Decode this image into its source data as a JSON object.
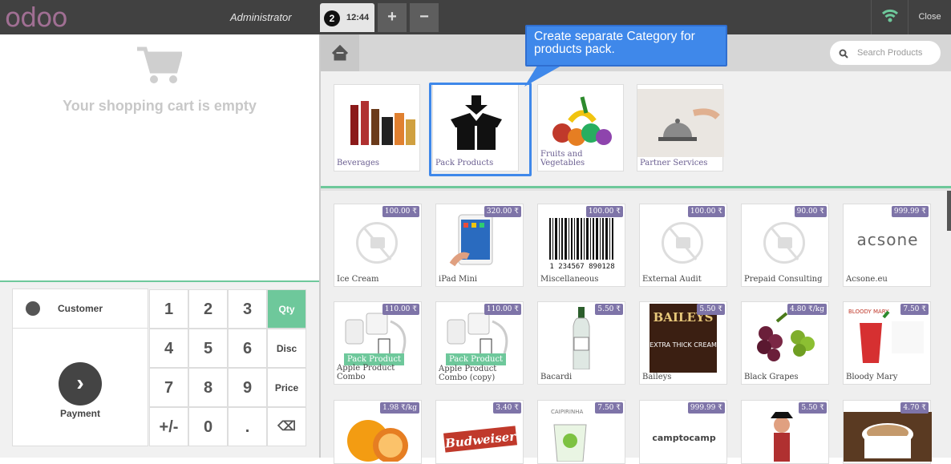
{
  "topbar": {
    "logo": "odoo",
    "user": "Administrator",
    "order_number": "2",
    "order_time": "12:44",
    "add_label": "+",
    "remove_label": "−",
    "close_label": "Close"
  },
  "cart": {
    "empty_text": "Your shopping cart is empty"
  },
  "actionpad": {
    "customer_label": "Customer",
    "payment_label": "Payment"
  },
  "numpad": {
    "keys": [
      "1",
      "2",
      "3",
      "4",
      "5",
      "6",
      "7",
      "8",
      "9",
      "+/-",
      "0",
      "."
    ],
    "modes": [
      "Qty",
      "Disc",
      "Price"
    ],
    "backspace": "⌫"
  },
  "search": {
    "placeholder": "Search Products"
  },
  "callout": {
    "text": "Create separate  Category for products pack."
  },
  "categories": [
    {
      "name": "Beverages"
    },
    {
      "name": "Pack Products"
    },
    {
      "name": "Fruits and Vegetables"
    },
    {
      "name": "Partner Services"
    }
  ],
  "products": {
    "row1": [
      {
        "name": "Ice Cream",
        "price": "100.00 ₹"
      },
      {
        "name": "iPad Mini",
        "price": "320.00 ₹"
      },
      {
        "name": "Miscellaneous",
        "price": "100.00 ₹"
      },
      {
        "name": "External Audit",
        "price": "100.00 ₹"
      },
      {
        "name": "Prepaid Consulting",
        "price": "90.00 ₹"
      },
      {
        "name": "Acsone.eu",
        "price": "999.99 ₹"
      }
    ],
    "row2": [
      {
        "name": "Apple Product Combo",
        "price": "110.00 ₹",
        "badge": "Pack Product"
      },
      {
        "name": "Apple Product Combo (copy)",
        "price": "110.00 ₹",
        "badge": "Pack Product"
      },
      {
        "name": "Bacardi",
        "price": "5.50 ₹"
      },
      {
        "name": "Baileys",
        "price": "5.50 ₹"
      },
      {
        "name": "Black Grapes",
        "price": "4.80 ₹/kg"
      },
      {
        "name": "Bloody Mary",
        "price": "7.50 ₹"
      }
    ],
    "row3": [
      {
        "price": "1.98 ₹/kg"
      },
      {
        "price": "3.40 ₹"
      },
      {
        "price": "7.50 ₹"
      },
      {
        "price": "999.99 ₹"
      },
      {
        "price": "5.50 ₹"
      },
      {
        "price": "4.70 ₹"
      }
    ]
  },
  "logos": {
    "acsone": "acsone",
    "camptocamp": "camptocamp",
    "budweiser": "Budweiser",
    "baileys": "BAILEYS",
    "baileys_sub": "EXTRA THICK CREAM",
    "caipirinha": "CAIPIRINHA",
    "bloody": "BLOODY MARY",
    "barcode_digits": "1 234567 890128"
  },
  "colors": {
    "accent": "#6ec89b",
    "brand": "#a06f93",
    "price_badge": "#7e74a8",
    "callout": "#3f88ea"
  }
}
